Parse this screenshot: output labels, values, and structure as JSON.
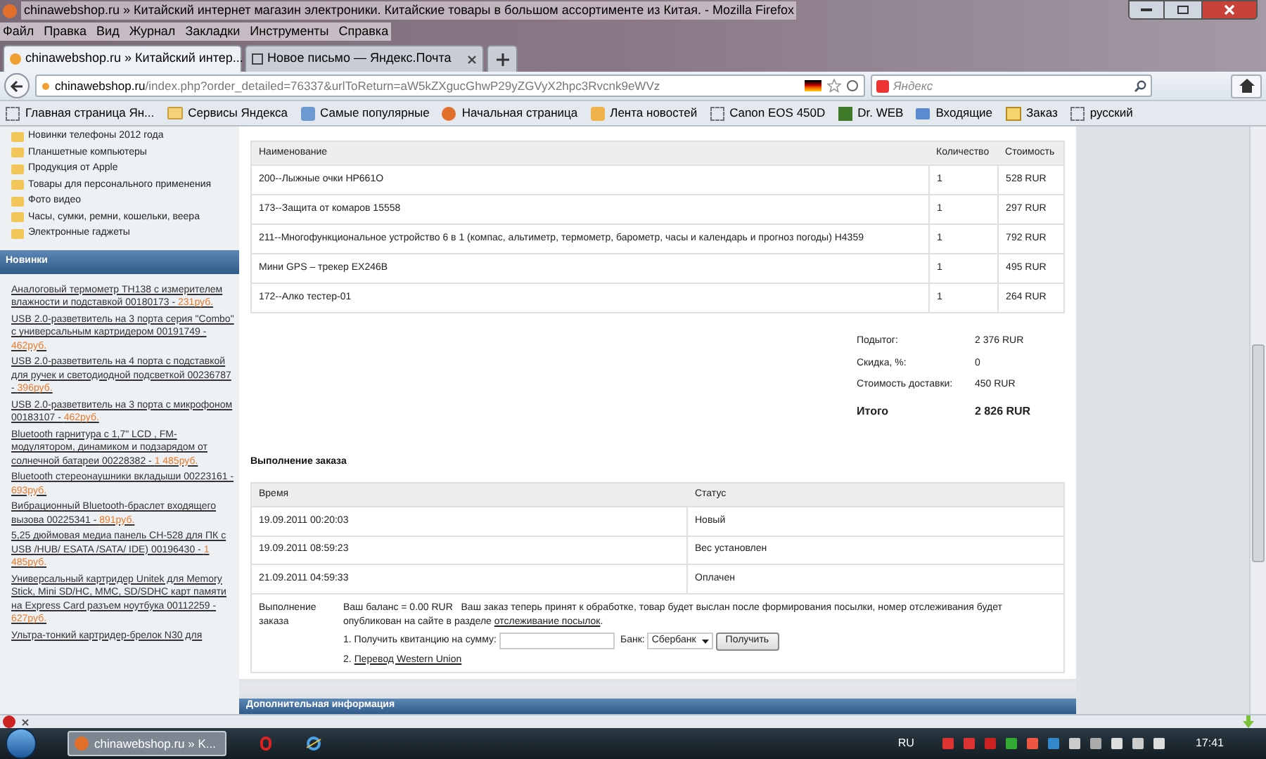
{
  "window": {
    "title": "chinawebshop.ru » Китайский интернет магазин электроники. Китайские товары в большом ассортименте из Китая. - Mozilla Firefox"
  },
  "menu": [
    "Файл",
    "Правка",
    "Вид",
    "Журнал",
    "Закладки",
    "Инструменты",
    "Справка"
  ],
  "tabs": [
    {
      "label": "chinawebshop.ru » Китайский интер...",
      "selected": true
    },
    {
      "label": "Новое письмо — Яндекс.Почта",
      "selected": false
    }
  ],
  "address_bar": {
    "domain": "chinawebshop.ru",
    "path": "/index.php?order_detailed=76337&urlToReturn=aW5kZXgucGhwP29yZGVyX2hpc3Rvcnk9eWVz"
  },
  "search": {
    "placeholder": "Яндекс"
  },
  "bookmarks": [
    {
      "label": "Главная страница Ян...",
      "kind": "dashed"
    },
    {
      "label": "Сервисы Яндекса",
      "kind": "folder"
    },
    {
      "label": "Самые популярные",
      "kind": "search"
    },
    {
      "label": "Начальная страница",
      "kind": "firefox"
    },
    {
      "label": "Лента новостей",
      "kind": "rss"
    },
    {
      "label": "Canon EOS 450D",
      "kind": "dashed"
    },
    {
      "label": "Dr. WEB",
      "kind": "drweb"
    },
    {
      "label": "Входящие",
      "kind": "mail"
    },
    {
      "label": "Заказ",
      "kind": "rt"
    },
    {
      "label": "русский",
      "kind": "dashed"
    }
  ],
  "sidebar": {
    "categories": [
      "Новинки телефоны 2012 года",
      "Планшетные компьютеры",
      "Продукция от Apple",
      "Товары для персонального применения",
      "Фото видео",
      "Часы, сумки, ремни, кошельки, веера",
      "Электронные гаджеты"
    ],
    "news_title": "Новинки",
    "news": [
      {
        "text": "Аналоговый термометр TH138 с измерителем влажности и подставкой 00180173 - ",
        "price": "231руб."
      },
      {
        "text": "USB 2.0-разветвитель на 3 порта серия \"Combo\" с универсальным картридером 00191749 - ",
        "price": "462руб."
      },
      {
        "text": "USB 2.0-разветвитель на 4 порта с подставкой для ручек и светодиодной подсветкой 00236787 - ",
        "price": "396руб."
      },
      {
        "text": "USB 2.0-разветвитель на 3 порта с микрофоном 00183107 - ",
        "price": "462руб."
      },
      {
        "text": "Bluetooth гарнитура с 1,7\" LCD , FM-модулятором, динамиком и подзарядом от солнечной батареи 00228382 - ",
        "price": "1 485руб."
      },
      {
        "text": "Bluetooth стереонаушники вкладыши 00223161 - ",
        "price": "693руб."
      },
      {
        "text": "Вибрационный Bluetooth-браслет входящего вызова 00225341 - ",
        "price": "891руб."
      },
      {
        "text": "5,25 дюймовая медиа панель CH-528 для ПК с USB /HUB/ ESATA /SATA/ IDE) 00196430 - ",
        "price": "1 485руб."
      },
      {
        "text": "Универсальный картридер Unitek для Memory Stick, Mini SD/HC, MMC, SD/SDHC карт памяти на Express Card разъем ноутбука 00112259 - ",
        "price": "627руб."
      },
      {
        "text": "Ультра-тонкий картридер-брелок N30 для"
      }
    ]
  },
  "order": {
    "columns": [
      "Наименование",
      "Количество",
      "Стоимость"
    ],
    "rows": [
      {
        "name": "200--Лыжные очки HP661O",
        "qty": "1",
        "cost": "528 RUR"
      },
      {
        "name": "173--Защита от комаров 15558",
        "qty": "1",
        "cost": "297 RUR"
      },
      {
        "name": "211--Многофункциональное устройство 6 в 1 (компас, альтиметр, термометр, барометр, часы и календарь и прогноз погоды) H4359",
        "qty": "1",
        "cost": "792 RUR"
      },
      {
        "name": "Мини GPS – трекер EX246B",
        "qty": "1",
        "cost": "495 RUR"
      },
      {
        "name": "172--Алко тестер-01",
        "qty": "1",
        "cost": "264 RUR"
      }
    ],
    "totals": [
      {
        "label": "Подытог:",
        "value": "2 376 RUR",
        "bold": false
      },
      {
        "label": "Скидка, %:",
        "value": "0",
        "bold": false
      },
      {
        "label": "Стоимость доставки:",
        "value": "450 RUR",
        "bold": false
      },
      {
        "label": "Итого",
        "value": "2 826 RUR",
        "bold": true
      }
    ]
  },
  "fulfillment": {
    "title": "Выполнение заказа",
    "columns": [
      "Время",
      "Статус"
    ],
    "rows": [
      {
        "time": "19.09.2011 00:20:03",
        "status": "Новый"
      },
      {
        "time": "19.09.2011 08:59:23",
        "status": "Вес установлен"
      },
      {
        "time": "21.09.2011 04:59:33",
        "status": "Оплачен"
      }
    ],
    "label": "Выполнение заказа",
    "balance": "Ваш баланс = 0.00 RUR",
    "message": "Ваш заказ теперь принят к обработке, товар будет выслан после формирования посылки, номер отслеживания будет опубликован на сайте в разделе",
    "tracking_link": "отслеживание посылок",
    "message_end": ".",
    "receipt_label": "1. Получить квитанцию на сумму:",
    "bank_label": "Банк:",
    "bank": "Сбербанк",
    "button": "Получить",
    "wu_prefix": "2.",
    "wu_link": "Перевод Western Union"
  },
  "extra_title": "Дополнительная информация",
  "taskbar": {
    "tasks": [
      {
        "label": "chinawebshop.ru » K...",
        "selected": true
      }
    ],
    "language": "RU",
    "time": "17:41"
  }
}
